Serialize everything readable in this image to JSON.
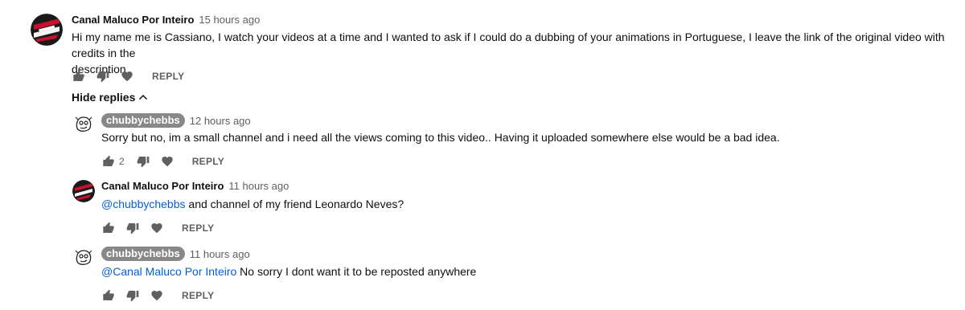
{
  "comments": [
    {
      "author": "Canal Maluco Por Inteiro",
      "time": "15 hours ago",
      "text": "Hi my name me is Cassiano, I watch your videos at a time and I wanted to ask if I could do a dubbing of your animations in Portuguese, I leave the link of the original video with credits in the",
      "text_line2": "description",
      "reply_label": "REPLY",
      "avatar_icon": "channel-logo-icon"
    }
  ],
  "hide_replies_label": "Hide replies",
  "replies": [
    {
      "author": "chubbychebbs",
      "time": "12 hours ago",
      "text": "Sorry but no, im a small channel and i need all the views coming to this video.. Having it uploaded somewhere else would be a bad idea.",
      "like_count": "2",
      "reply_label": "REPLY",
      "avatar_icon": "doodle-face-icon"
    },
    {
      "author": "Canal Maluco Por Inteiro",
      "time": "11 hours ago",
      "mention": "@chubbychebbs",
      "text": " and channel of my friend Leonardo Neves?",
      "reply_label": "REPLY",
      "avatar_icon": "channel-logo-icon"
    },
    {
      "author": "chubbychebbs",
      "time": "11 hours ago",
      "mention": "@Canal Maluco Por Inteiro",
      "text": " No sorry I dont want it to be reposted anywhere",
      "reply_label": "REPLY",
      "avatar_icon": "doodle-face-icon"
    }
  ],
  "colors": {
    "mention": "#065fd4",
    "secondary_text": "#606060",
    "owner_pill": "#888888"
  }
}
